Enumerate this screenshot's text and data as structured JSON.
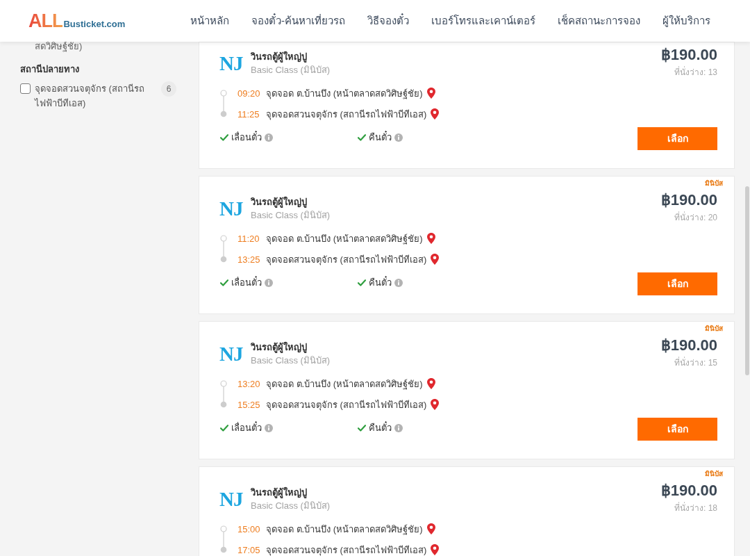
{
  "header": {
    "logo": {
      "main": "ALL",
      "sub": "Busticket.com"
    },
    "nav": [
      "หน้าหลัก",
      "จองตั๋ว-ค้นหาเที่ยวรถ",
      "วิธีจองตั๋ว",
      "เบอร์โทรและเคาน์เตอร์",
      "เช็คสถานะการจอง",
      "ผู้ให้บริการ"
    ]
  },
  "sidebar": {
    "cut_off_text": "สดวิศิษฐ์ชัย)",
    "filter_groups": [
      {
        "title": "สถานีปลายทาง",
        "options": [
          {
            "label": "จุดจอดสวนจตุจักร (สถานีรถไฟฟ้าบีทีเอส)",
            "count": "6",
            "checked": false
          }
        ]
      }
    ]
  },
  "trips": [
    {
      "operator_logo": "NJ",
      "operator": "วินรถตู้ผู้ใหญ่ปู",
      "class": "Basic Class (มินิบัส)",
      "price": "฿190.00",
      "seats": "ที่นั่งว่าง: 13",
      "stops": [
        {
          "time": "09:20",
          "place": "จุดจอด ต.บ้านบึง (หน้าตลาดสดวิศิษฐ์ชัย)"
        },
        {
          "time": "11:25",
          "place": "จุดจอดสวนจตุจักร (สถานีรถไฟฟ้าบีทีเอส)"
        }
      ],
      "features": [
        {
          "label": "เลื่อนตั๋ว",
          "available": true
        },
        {
          "label": "คืนตั๋ว",
          "available": true
        }
      ],
      "button": "เลือก"
    },
    {
      "tag": "มินิบัส",
      "operator_logo": "NJ",
      "operator": "วินรถตู้ผู้ใหญ่ปู",
      "class": "Basic Class (มินิบัส)",
      "price": "฿190.00",
      "seats": "ที่นั่งว่าง: 20",
      "stops": [
        {
          "time": "11:20",
          "place": "จุดจอด ต.บ้านบึง (หน้าตลาดสดวิศิษฐ์ชัย)"
        },
        {
          "time": "13:25",
          "place": "จุดจอดสวนจตุจักร (สถานีรถไฟฟ้าบีทีเอส)"
        }
      ],
      "features": [
        {
          "label": "เลื่อนตั๋ว",
          "available": true
        },
        {
          "label": "คืนตั๋ว",
          "available": true
        }
      ],
      "button": "เลือก"
    },
    {
      "tag": "มินิบัส",
      "operator_logo": "NJ",
      "operator": "วินรถตู้ผู้ใหญ่ปู",
      "class": "Basic Class (มินิบัส)",
      "price": "฿190.00",
      "seats": "ที่นั่งว่าง: 15",
      "stops": [
        {
          "time": "13:20",
          "place": "จุดจอด ต.บ้านบึง (หน้าตลาดสดวิศิษฐ์ชัย)"
        },
        {
          "time": "15:25",
          "place": "จุดจอดสวนจตุจักร (สถานีรถไฟฟ้าบีทีเอส)"
        }
      ],
      "features": [
        {
          "label": "เลื่อนตั๋ว",
          "available": true
        },
        {
          "label": "คืนตั๋ว",
          "available": true
        }
      ],
      "button": "เลือก"
    },
    {
      "tag": "มินิบัส",
      "operator_logo": "NJ",
      "operator": "วินรถตู้ผู้ใหญ่ปู",
      "class": "Basic Class (มินิบัส)",
      "price": "฿190.00",
      "seats": "ที่นั่งว่าง: 18",
      "stops": [
        {
          "time": "15:00",
          "place": "จุดจอด ต.บ้านบึง (หน้าตลาดสดวิศิษฐ์ชัย)"
        },
        {
          "time": "17:05",
          "place": "จุดจอดสวนจตุจักร (สถานีรถไฟฟ้าบีทีเอส)"
        }
      ]
    }
  ]
}
